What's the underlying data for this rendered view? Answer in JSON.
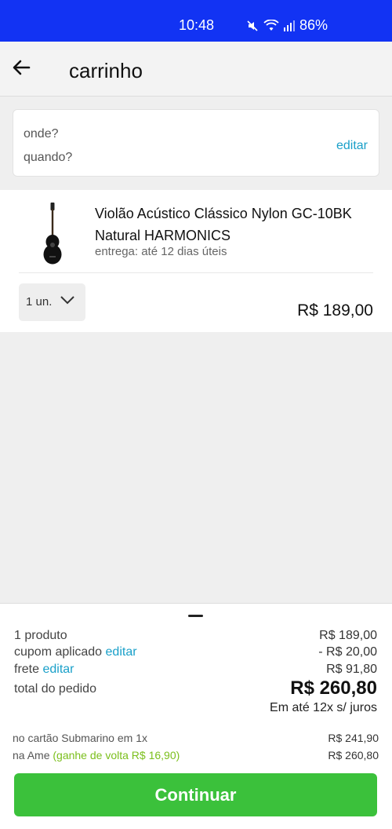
{
  "status_bar": {
    "time": "10:48",
    "battery": "86%",
    "icons": [
      "mute-icon",
      "wifi-icon",
      "signal-icon"
    ]
  },
  "header": {
    "title": "carrinho"
  },
  "location": {
    "where_placeholder": "onde?",
    "when_placeholder": "quando?",
    "edit_label": "editar"
  },
  "cart_item": {
    "title": "Violão Acústico Clássico Nylon GC-10BK Natural HARMONICS",
    "delivery": "entrega: até 12 dias úteis",
    "quantity": "1 un.",
    "price": "R$ 189,00"
  },
  "summary": {
    "products_label": "1 produto",
    "products_value": "R$ 189,00",
    "coupon_label": "cupom aplicado",
    "coupon_edit": "editar",
    "coupon_value": "- R$ 20,00",
    "shipping_label": "frete",
    "shipping_edit": "editar",
    "shipping_value": "R$ 91,80",
    "total_label": "total do pedido",
    "total_value": "R$ 260,80",
    "installments": "Em até 12x s/ juros",
    "card_label": "no cartão Submarino em 1x",
    "card_value": "R$ 241,90",
    "ame_label": "na Ame",
    "ame_cashback": "(ganhe de volta R$ 16,90)",
    "ame_value": "R$ 260,80",
    "continue_label": "Continuar"
  },
  "colors": {
    "status_bar": "#1233f3",
    "link": "#1aa0c9",
    "discount": "#7bbf1c",
    "cta": "#3bc13b"
  }
}
